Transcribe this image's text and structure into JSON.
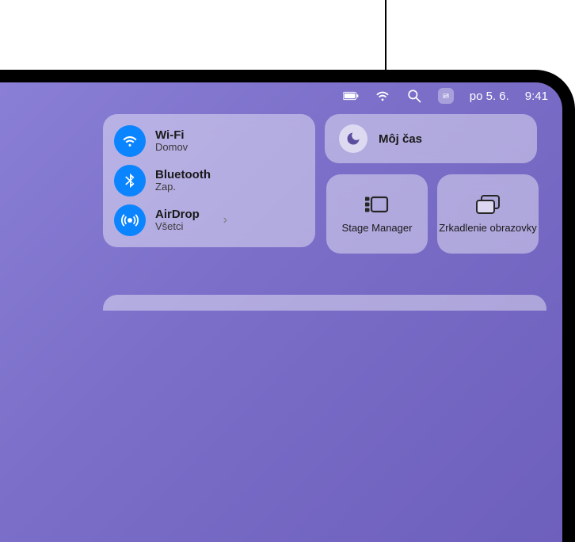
{
  "menubar": {
    "date": "po 5. 6.",
    "time": "9:41"
  },
  "cc": {
    "wifi": {
      "title": "Wi-Fi",
      "status": "Domov"
    },
    "bluetooth": {
      "title": "Bluetooth",
      "status": "Zap."
    },
    "airdrop": {
      "title": "AirDrop",
      "status": "Všetci"
    },
    "focus": {
      "title": "Môj čas"
    },
    "stage": {
      "label": "Stage Manager"
    },
    "mirror": {
      "label": "Zrkadlenie obrazovky"
    }
  }
}
